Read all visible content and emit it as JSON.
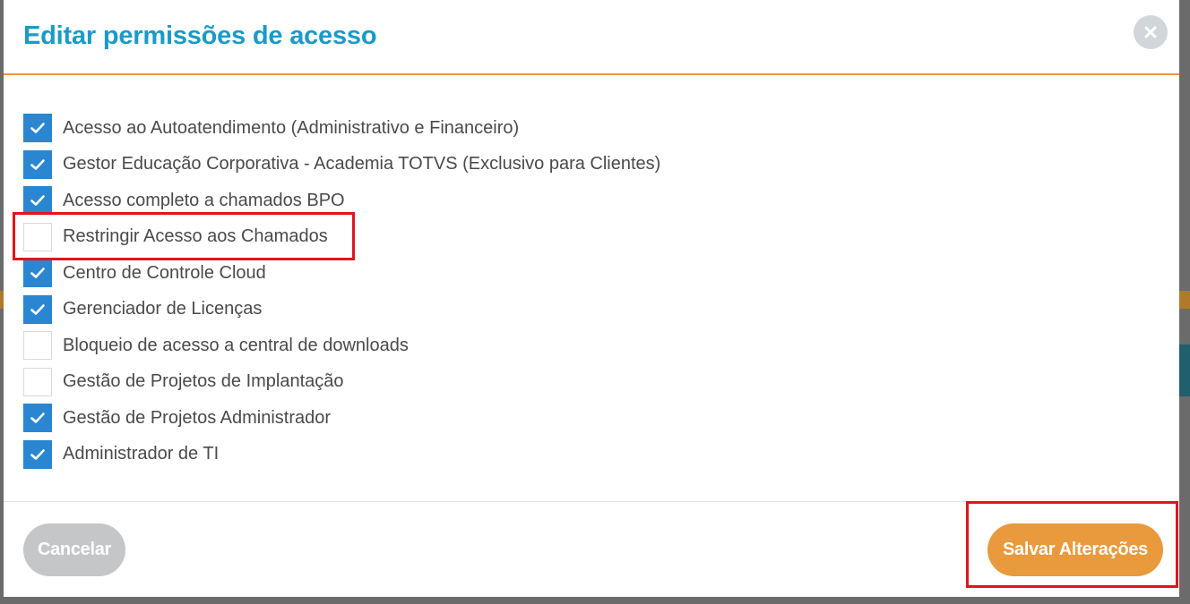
{
  "modal": {
    "title": "Editar permissões de acesso",
    "close_icon": "close-icon"
  },
  "permissions": [
    {
      "label": "Acesso ao Autoatendimento (Administrativo e Financeiro)",
      "checked": true
    },
    {
      "label": "Gestor Educação Corporativa - Academia TOTVS (Exclusivo para Clientes)",
      "checked": true
    },
    {
      "label": "Acesso completo a chamados BPO",
      "checked": true
    },
    {
      "label": "Restringir Acesso aos Chamados",
      "checked": false
    },
    {
      "label": "Centro de Controle Cloud",
      "checked": true
    },
    {
      "label": "Gerenciador de Licenças",
      "checked": true
    },
    {
      "label": "Bloqueio de acesso a central de downloads",
      "checked": false
    },
    {
      "label": "Gestão de Projetos de Implantação",
      "checked": false
    },
    {
      "label": "Gestão de Projetos Administrador",
      "checked": true
    },
    {
      "label": "Administrador de TI",
      "checked": true
    }
  ],
  "footer": {
    "cancel_label": "Cancelar",
    "save_label": "Salvar Alterações"
  },
  "colors": {
    "title": "#1a9bc7",
    "accent": "#e89a3c",
    "checkbox_checked": "#2a86d1",
    "highlight": "#e0141e",
    "cancel_bg": "#c4c6c8"
  }
}
